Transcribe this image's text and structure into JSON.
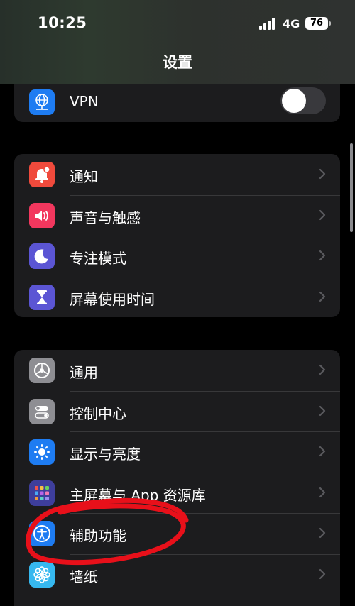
{
  "status_bar": {
    "time": "10:25",
    "network": "4G",
    "battery": "76"
  },
  "nav": {
    "title": "设置"
  },
  "groups": [
    {
      "items": [
        {
          "label": "VPN",
          "icon": "vpn-globe-icon",
          "color": "#1e7cf2",
          "control": "toggle",
          "toggle_on": false
        }
      ]
    },
    {
      "items": [
        {
          "label": "通知",
          "icon": "bell-icon",
          "color": "#f04a3c"
        },
        {
          "label": "声音与触感",
          "icon": "speaker-icon",
          "color": "#f2375e"
        },
        {
          "label": "专注模式",
          "icon": "moon-icon",
          "color": "#5b55d4"
        },
        {
          "label": "屏幕使用时间",
          "icon": "hourglass-icon",
          "color": "#5b55d4"
        }
      ]
    },
    {
      "items": [
        {
          "label": "通用",
          "icon": "gear-icon",
          "color": "#8e8e93"
        },
        {
          "label": "控制中心",
          "icon": "switches-icon",
          "color": "#8e8e93"
        },
        {
          "label": "显示与亮度",
          "icon": "sun-icon",
          "color": "#1e7cf2"
        },
        {
          "label": "主屏幕与 App 资源库",
          "icon": "app-grid-icon",
          "color": "#3e3e9c"
        },
        {
          "label": "辅助功能",
          "icon": "accessibility-icon",
          "color": "#1e7cf2"
        },
        {
          "label": "墙纸",
          "icon": "flower-icon",
          "color": "#36b8ef"
        }
      ]
    }
  ],
  "annotation": {
    "color": "#e8101a",
    "target": "辅助功能"
  }
}
